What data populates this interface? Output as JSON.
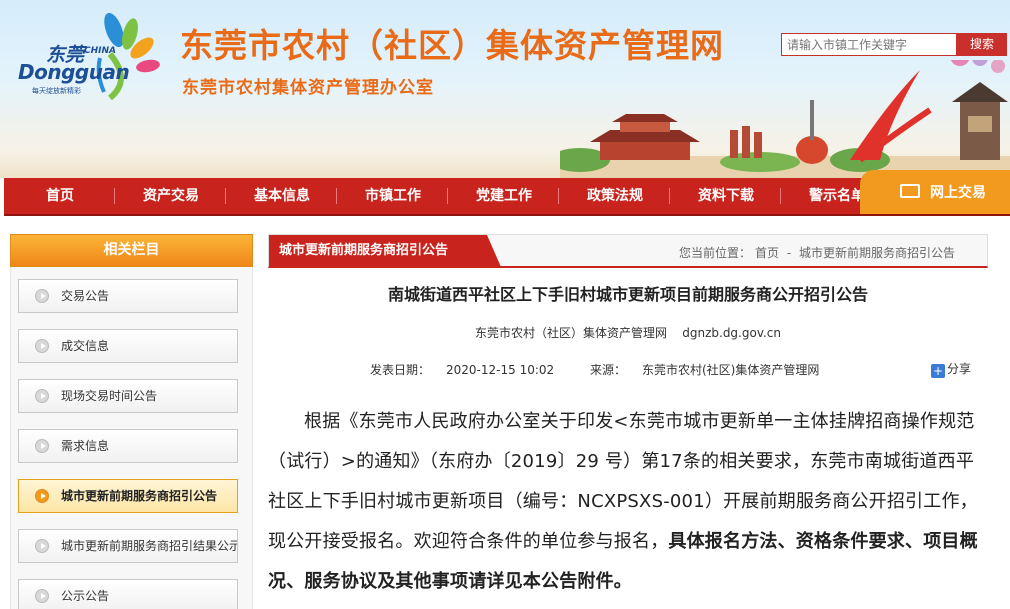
{
  "header": {
    "logo": {
      "cn": "东莞",
      "china": "CHINA",
      "en": "Dongguan",
      "slogan": "每天绽放新精彩"
    },
    "title": "东莞市农村（社区）集体资产管理网",
    "subtitle": "东莞市农村集体资产管理办公室",
    "search": {
      "placeholder": "请输入市镇工作关键字",
      "button": "搜索"
    }
  },
  "nav": {
    "items": [
      "首页",
      "资产交易",
      "基本信息",
      "市镇工作",
      "党建工作",
      "政策法规",
      "资料下载",
      "警示名单"
    ],
    "online": "网上交易"
  },
  "sidebar": {
    "title": "相关栏目",
    "items": [
      {
        "label": "交易公告"
      },
      {
        "label": "成交信息"
      },
      {
        "label": "现场交易时间公告"
      },
      {
        "label": "需求信息"
      },
      {
        "label": "城市更新前期服务商招引公告"
      },
      {
        "label": "城市更新前期服务商招引结果公示"
      },
      {
        "label": "公示公告"
      }
    ],
    "active_index": 4
  },
  "content": {
    "section_tag": "城市更新前期服务商招引公告",
    "breadcrumb": {
      "prefix": "您当前位置：",
      "home": "首页",
      "sep": " - ",
      "current": "城市更新前期服务商招引公告"
    },
    "title": "南城街道西平社区上下手旧村城市更新项目前期服务商公开招引公告",
    "source_line": "东莞市农村（社区）集体资产管理网    dgnzb.dg.gov.cn",
    "publish_label": "发表日期：",
    "publish_date": "2020-12-15 10:02",
    "source_label": "来源：",
    "source_value": "东莞市农村(社区)集体资产管理网",
    "share": "分享",
    "body_normal": "根据《东莞市人民政府办公室关于印发<东莞市城市更新单一主体挂牌招商操作规范（试行）>的通知》（东府办〔2019〕29 号）第17条的相关要求，东莞市南城街道西平社区上下手旧村城市更新项目（编号：NCXPSXS-001）开展前期服务商公开招引工作，现公开接受报名。欢迎符合条件的单位参与报名，",
    "body_bold": "具体报名方法、资格条件要求、项目概况、服务协议及其他事项请详见本公告附件。"
  }
}
